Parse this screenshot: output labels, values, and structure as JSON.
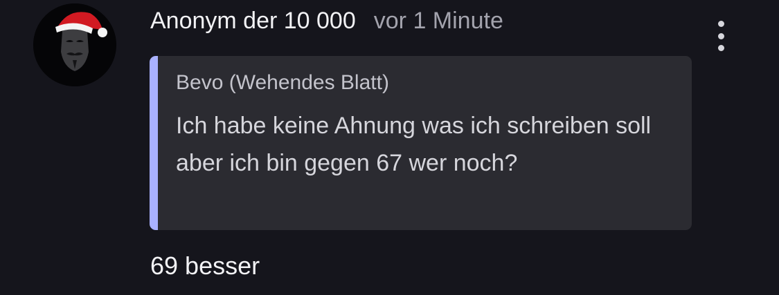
{
  "comment": {
    "author": "Anonym der 10 000",
    "time": "vor 1 Minute",
    "avatar_icon": "anonymous-mask-santa-hat",
    "more_icon": "vertical-ellipsis",
    "quote": {
      "author": "Bevo (Wehendes Blatt)",
      "text": "Ich habe keine Ahnung was ich schreiben soll aber ich bin gegen 67 wer noch?",
      "accent_color": "#a9b1ff"
    },
    "reply_text": "69 besser"
  },
  "colors": {
    "background": "#15151c",
    "quote_background": "#2b2b31",
    "muted_text": "#a3a3ad"
  }
}
